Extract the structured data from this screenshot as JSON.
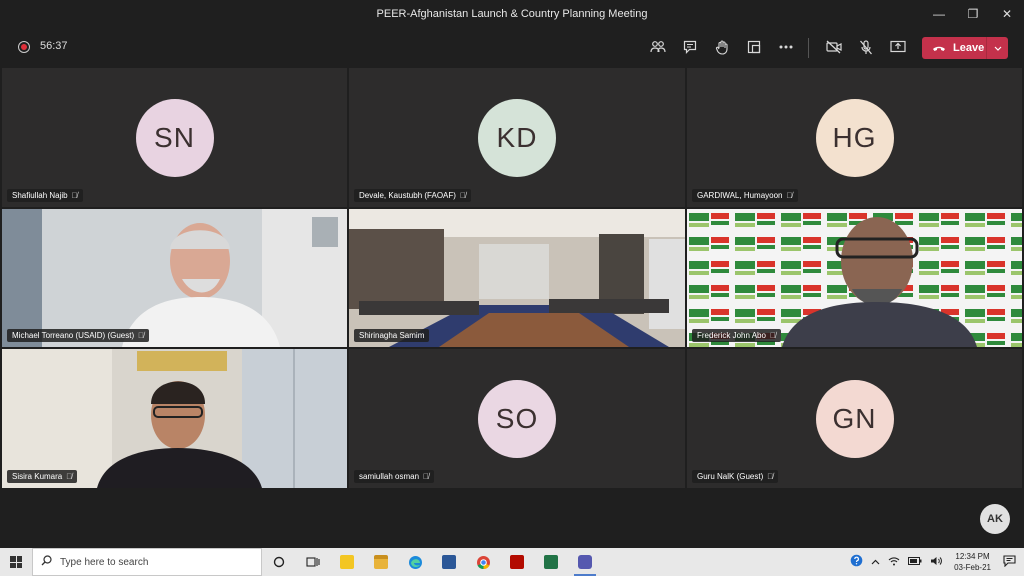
{
  "window": {
    "title": "PEER-Afghanistan Launch & Country Planning Meeting",
    "minimize": "—",
    "maximize": "❐",
    "close": "✕"
  },
  "toolbar": {
    "timer": "56:37",
    "leave_label": "Leave",
    "leave_color": "#c4314b"
  },
  "participants": [
    {
      "name": "Shafiullah Najib",
      "initials": "SN",
      "avatar_color": "#e8d3e1",
      "video": false
    },
    {
      "name": "Devale, Kaustubh (FAOAF)",
      "initials": "KD",
      "avatar_color": "#d5e3d8",
      "video": false
    },
    {
      "name": "GARDIWAL, Humayoon",
      "initials": "HG",
      "avatar_color": "#f3e1cf",
      "video": false
    },
    {
      "name": "Michael Torreano (USAID) (Guest)",
      "initials": "",
      "video": true
    },
    {
      "name": "Shirinagha Samim",
      "initials": "",
      "video": true
    },
    {
      "name": "Frederick John Abo",
      "initials": "",
      "video": true
    },
    {
      "name": "Sisira Kumara",
      "initials": "",
      "video": true
    },
    {
      "name": "samiullah osman",
      "initials": "SO",
      "avatar_color": "#ead7e3",
      "video": false
    },
    {
      "name": "Guru NalK (Guest)",
      "initials": "GN",
      "avatar_color": "#f3d9d2",
      "video": false
    }
  ],
  "self_avatar": "AK",
  "taskbar": {
    "search_placeholder": "Type here to search",
    "time": "12:34 PM",
    "date": "03-Feb-21"
  }
}
